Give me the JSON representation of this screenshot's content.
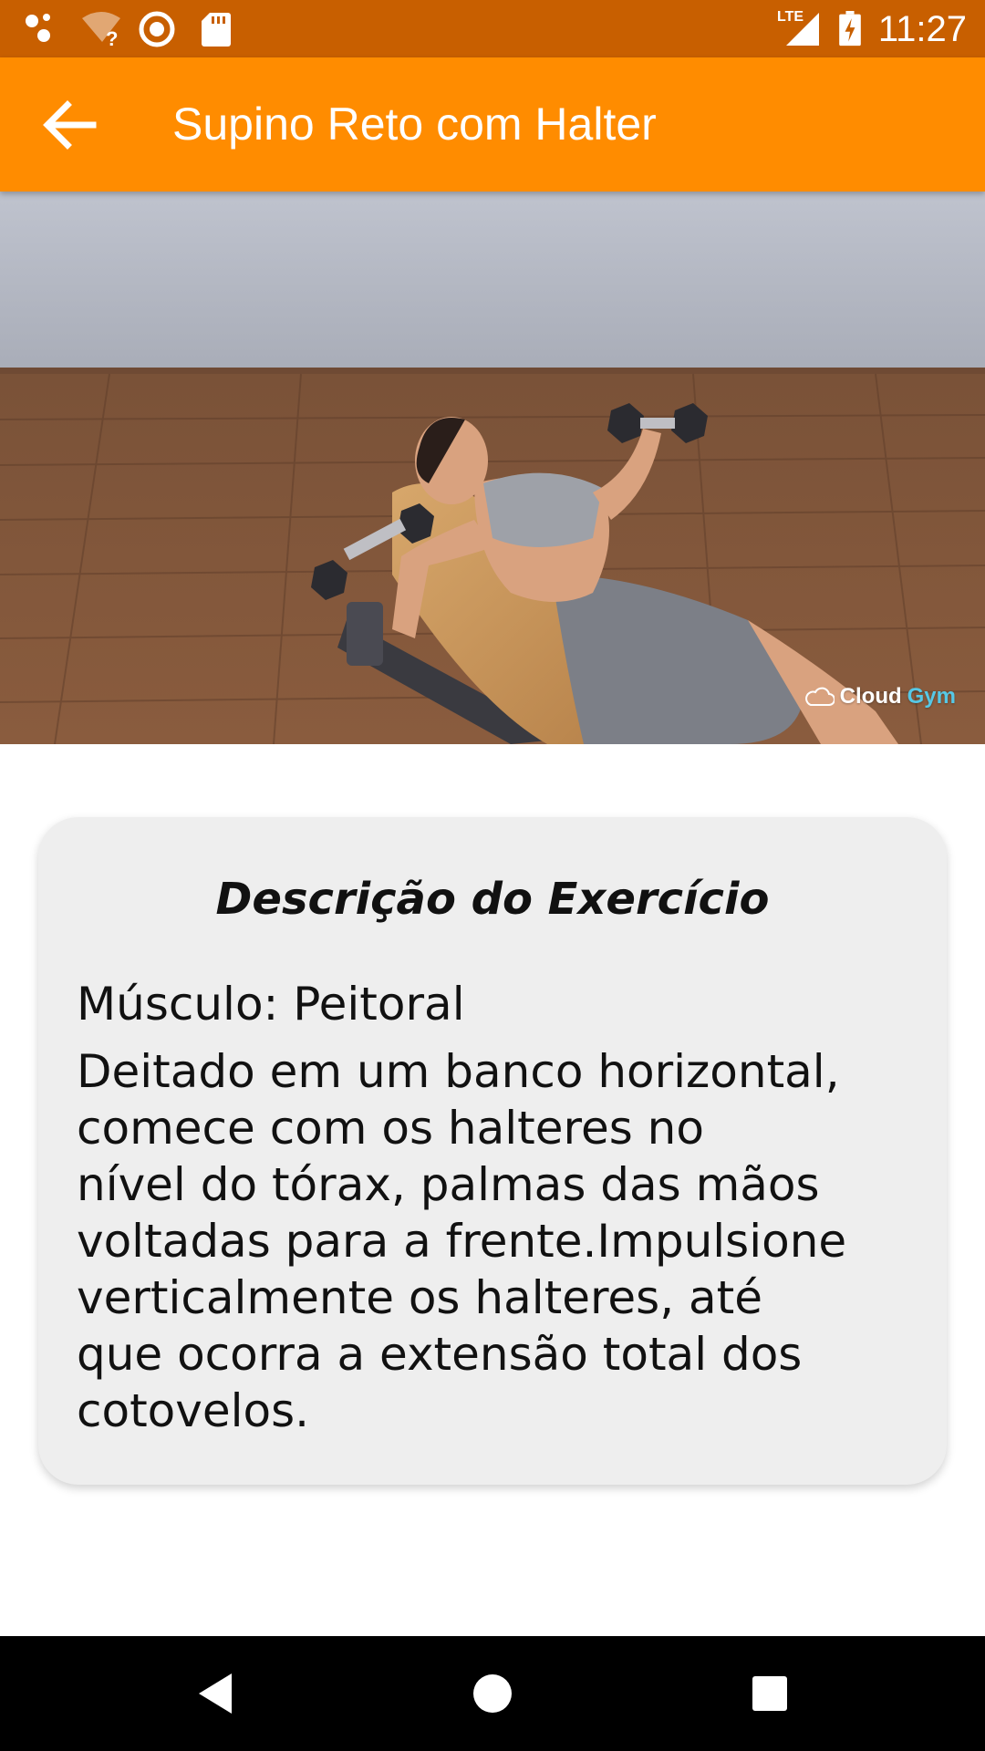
{
  "status_bar": {
    "time": "11:27",
    "network_type": "LTE",
    "icons": [
      "assistant-dots-icon",
      "wifi-unknown-icon",
      "circle-notification-icon",
      "sd-card-icon",
      "lte-signal-icon",
      "battery-charging-icon"
    ]
  },
  "app_bar": {
    "title": "Supino Reto com Halter",
    "back_icon": "arrow-back-icon"
  },
  "exercise_image": {
    "watermark_brand_1": "Cloud",
    "watermark_brand_2": "Gym"
  },
  "card": {
    "title": "Descrição do Exercício",
    "muscle": "Músculo: Peitoral",
    "description": "Deitado em um banco horizontal,\ncomece com os halteres no\nnível do tórax, palmas das mãos\nvoltadas para a frente.Impulsione\nverticalmente os halteres, até\nque ocorra a extensão total dos\ncotovelos."
  },
  "nav_bar": {
    "buttons": [
      "back-triangle-icon",
      "home-circle-icon",
      "recents-square-icon"
    ]
  },
  "colors": {
    "status_bar": "#c85f00",
    "app_bar": "#ff8c00",
    "card_background": "#eeeeee",
    "nav_bar": "#000000"
  }
}
